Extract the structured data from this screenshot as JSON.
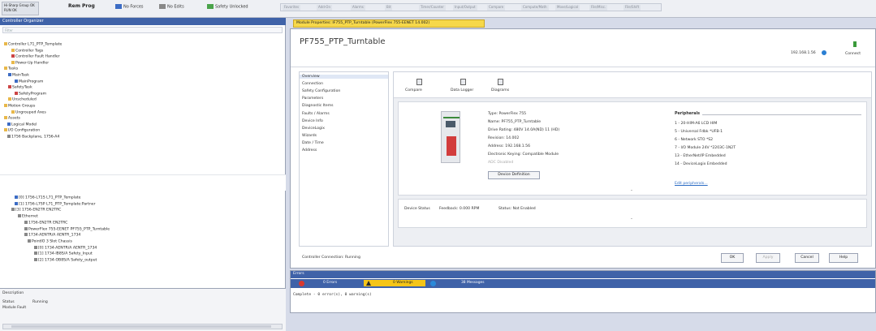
{
  "toolbar": {
    "status_box_line1": "Hi-Sharp Group OK",
    "status_box_line2": "RUN OK",
    "mode": "Rem Prog",
    "forces": "No Forces",
    "edits": "No Edits",
    "safety": "Safety Unlocked",
    "top_tabs": [
      "Favorites",
      "Add-On",
      "Alarms",
      "Bit",
      "Timer/Counter",
      "Input/Output",
      "Compare",
      "Compute/Math",
      "Move/Logical",
      "File/Misc.",
      "File/Shift"
    ]
  },
  "organizer": {
    "title": "Controller Organizer",
    "filter_placeholder": "Filter",
    "tree": [
      "Controller L71_PTP_Template",
      "Controller Tags",
      "Controller Fault Handler",
      "Power-Up Handler",
      "Tasks",
      "MainTask",
      "MainProgram",
      "SafetyTask",
      "SafetyProgram",
      "Unscheduled",
      "Motion Groups",
      "Ungrouped Axes",
      "Assets",
      "Logical Model",
      "I/O Configuration",
      "1756 Backplane, 1756-A4",
      "[0] 1756-L71S L71_PTP_Template",
      "[1] 1756-L7SP L71_PTP_Template:Partner",
      "[3] 1756-EN2TR EN2TRC",
      "Ethernet",
      "1756-EN2TR EN2TRC",
      "PowerFlex 755-EENET PF755_PTP_Turntable",
      "1734-AENTR/A AENTR_1734",
      "PointIO 3 Slot Chassis",
      "[0] 1734-AENTR/A AENTR_1734",
      "[1] 1734-IB8S/A Safety_Input",
      "[2] 1734-OB8S/A Safety_output"
    ],
    "description_label": "Description",
    "status_label": "Status",
    "status_value": "Running",
    "module_fault_label": "Module Fault"
  },
  "doc_tab": "Module Properties: IF755_PTP_Turntable (PowerFlex 755-EENET 14.002)",
  "module": {
    "title": "PF755_PTP_Turntable",
    "ip": "192.168.1.56",
    "connect": "Connect",
    "categories": [
      "Overview",
      "Connection",
      "Safety Configuration",
      "Parameters",
      "Diagnostic Items",
      "Faults / Alarms",
      "Device Info",
      "DeviceLogix",
      "Wizards",
      "Date / Time",
      "Address"
    ],
    "selected_category": "Overview",
    "commands": [
      "Compare",
      "Data Logger",
      "Diagrams"
    ],
    "overview": {
      "type": "Type: PowerFlex 755",
      "name": "Name: PF755_PTP_Turntable",
      "rating": "Drive Rating: 480V 14.0A(ND) 11 (HD)",
      "revision": "Revision: 14.002",
      "address": "Address: 192.168.1.56",
      "keying": "Electronic Keying: Compatible Module",
      "adc": "ADC Disabled",
      "device_definition": "Device Definition"
    },
    "peripherals": {
      "title": "Peripherals",
      "items": [
        "1 - 20-HIM-A6 LCD HIM",
        "5 - Universal Fdbk *UFB-1",
        "6 - Network STO *S2",
        "7 - I/O Module 24V *2203C-1N2T",
        "13 - EtherNet/IP Embedded",
        "14 - DeviceLogix Embedded"
      ],
      "edit_link": "Edit peripherals..."
    },
    "status": {
      "device_status": "Device Status",
      "feedback": "Feedback: 0.000 RPM",
      "status": "Status: Not Enabled"
    },
    "chevron": "⌄",
    "connection_status": "Controller Connection: Running",
    "buttons": {
      "ok": "OK",
      "apply": "Apply",
      "cancel": "Cancel",
      "help": "Help"
    }
  },
  "errors": {
    "title": "Errors",
    "errors_btn": "0 Errors",
    "warnings_btn": "0 Warnings",
    "messages_btn": "38 Messages",
    "output": "Complete - 0 error(s), 0 warning(s)"
  },
  "colors": {
    "accent": "#3f62a8",
    "tab": "#f6d84a",
    "warning": "#f5c518",
    "error": "#d8382f",
    "info": "#2b8ad9"
  }
}
